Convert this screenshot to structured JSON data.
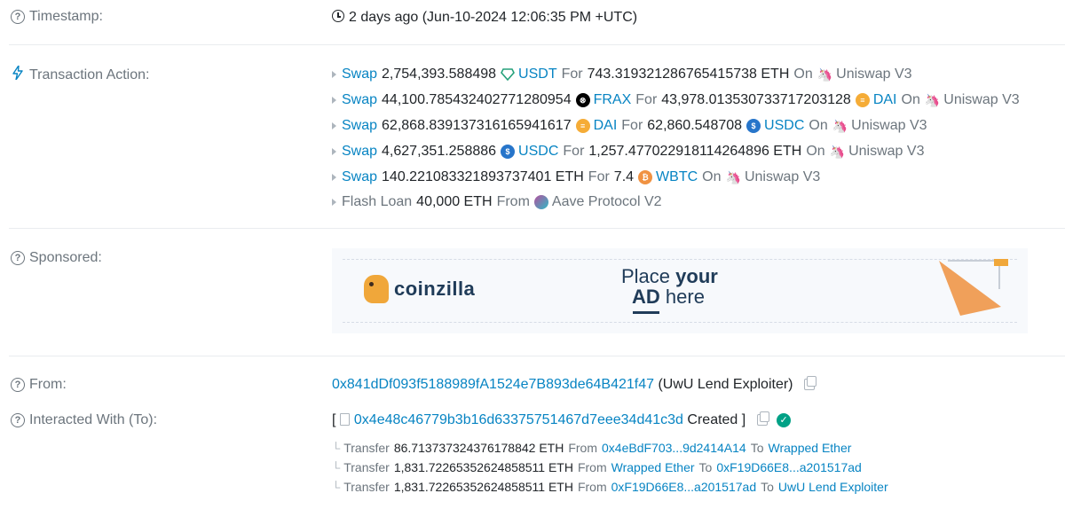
{
  "timestamp": {
    "label": "Timestamp:",
    "value": "2 days ago (Jun-10-2024 12:06:35 PM +UTC)"
  },
  "transaction_action": {
    "label": "Transaction Action:",
    "swaps": [
      {
        "verb": "Swap",
        "amount_in": "2,754,393.588498",
        "token_in": "USDT",
        "token_in_color": "#26a17b",
        "for": "For",
        "amount_out": "743.319321286765415738 ETH",
        "token_out": "",
        "on": "On",
        "dex": "Uniswap V3"
      },
      {
        "verb": "Swap",
        "amount_in": "44,100.785432402771280954",
        "token_in": "FRAX",
        "token_in_color": "#000000",
        "for": "For",
        "amount_out": "43,978.013530733717203128",
        "token_out": "DAI",
        "token_out_color": "#f5ac37",
        "on": "On",
        "dex": "Uniswap V3"
      },
      {
        "verb": "Swap",
        "amount_in": "62,868.839137316165941617",
        "token_in": "DAI",
        "token_in_color": "#f5ac37",
        "for": "For",
        "amount_out": "62,860.548708",
        "token_out": "USDC",
        "token_out_color": "#2775ca",
        "on": "On",
        "dex": "Uniswap V3"
      },
      {
        "verb": "Swap",
        "amount_in": "4,627,351.258886",
        "token_in": "USDC",
        "token_in_color": "#2775ca",
        "for": "For",
        "amount_out": "1,257.477022918114264896 ETH",
        "token_out": "",
        "on": "On",
        "dex": "Uniswap V3"
      },
      {
        "verb": "Swap",
        "amount_in": "140.221083321893737401 ETH",
        "token_in": "",
        "for": "For",
        "amount_out": "7.4",
        "token_out": "WBTC",
        "token_out_color": "#f09242",
        "on": "On",
        "dex": "Uniswap V3"
      }
    ],
    "flash_loan": {
      "prefix": "Flash Loan",
      "amount": "40,000 ETH",
      "from": "From",
      "protocol": "Aave Protocol V2"
    }
  },
  "sponsored": {
    "label": "Sponsored:",
    "ad_brand": "coinzilla",
    "ad_line1_a": "Place ",
    "ad_line1_b": "your",
    "ad_line2_a": "AD",
    "ad_line2_b": " here"
  },
  "from": {
    "label": "From:",
    "address": "0x841dDf093f5188989fA1524e7B893de64B421f47",
    "name": "(UwU Lend Exploiter)"
  },
  "interacted_with": {
    "label": "Interacted With (To):",
    "bracket_open": "[",
    "address": "0x4e48c46779b3b16d63375751467d7eee34d41c3d",
    "created": "Created",
    "bracket_close": "]",
    "transfers": [
      {
        "verb": "Transfer",
        "amount": "86.713737324376178842 ETH",
        "from_word": "From",
        "from": "0x4eBdF703...9d2414A14",
        "to_word": "To",
        "to": "Wrapped Ether"
      },
      {
        "verb": "Transfer",
        "amount": "1,831.72265352624858511 ETH",
        "from_word": "From",
        "from": "Wrapped Ether",
        "to_word": "To",
        "to": "0xF19D66E8...a201517ad"
      },
      {
        "verb": "Transfer",
        "amount": "1,831.72265352624858511 ETH",
        "from_word": "From",
        "from": "0xF19D66E8...a201517ad",
        "to_word": "To",
        "to": "UwU Lend Exploiter"
      }
    ]
  },
  "colors": {
    "link": "#0784c3",
    "muted": "#6c757d",
    "success": "#00a186"
  }
}
